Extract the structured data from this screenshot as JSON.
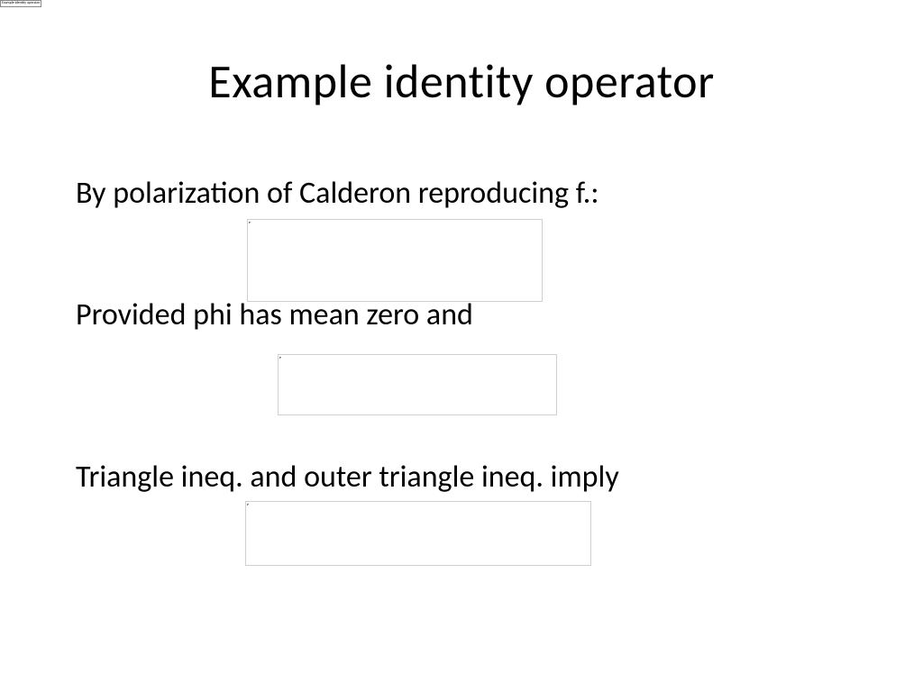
{
  "top_tab_label": "Example identity operator",
  "slide": {
    "title": "Example identity operator",
    "line1": "By polarization of Calderon reproducing f.:",
    "line2": "Provided phi has mean zero and",
    "line3": "Triangle ineq. and outer triangle ineq. imply"
  }
}
